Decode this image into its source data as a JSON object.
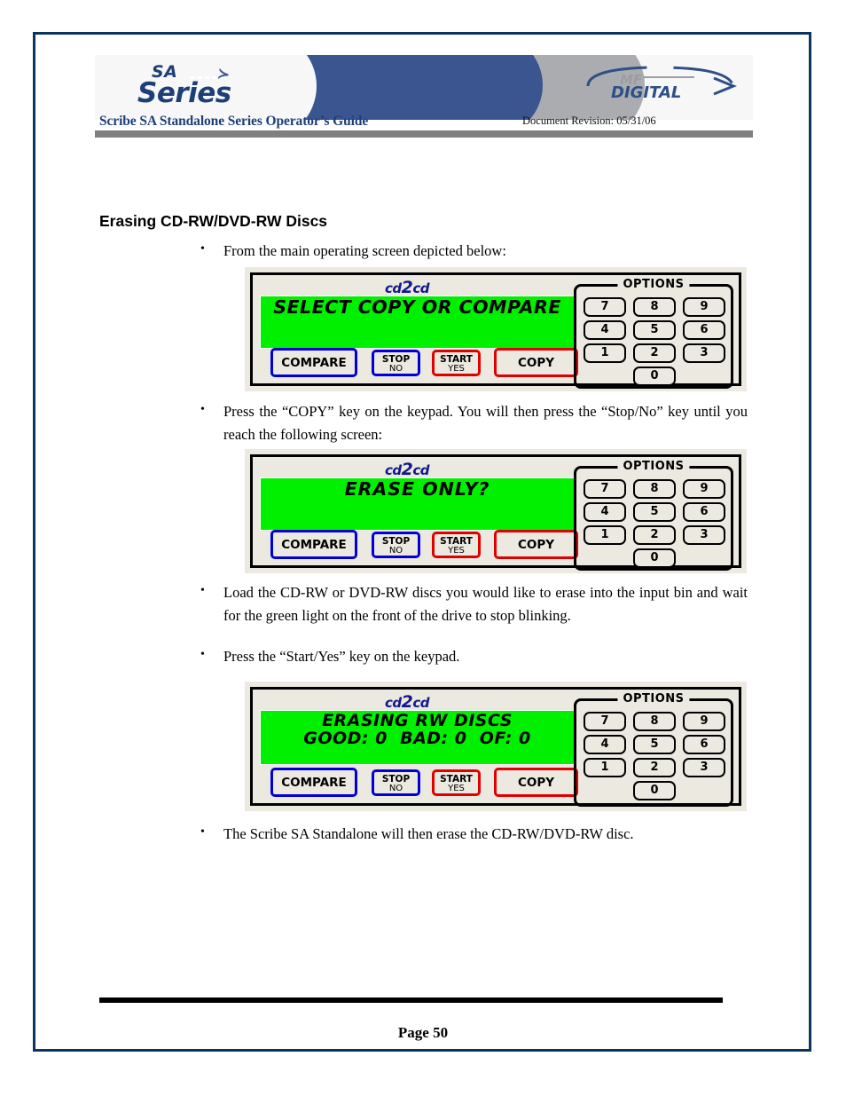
{
  "document": {
    "header": {
      "logo_sa_top": "SA",
      "logo_sa_bottom": "Series",
      "logo_bird": "≻",
      "brand_mf": "MF",
      "brand_digital": "DIGITAL",
      "title": "Scribe SA Standalone Series Operator’s Guide",
      "revision": "Document Revision: 05/31/06"
    },
    "section_heading": "Erasing CD-RW/DVD-RW Discs",
    "bullets": {
      "b1": "From the main operating screen depicted below:",
      "b2": "Press the “COPY” key on the keypad. You will then press the “Stop/No” key until you reach the following screen:",
      "b3": "Load the CD-RW or DVD-RW discs you would like to erase into the input bin and wait for the green light on the front of the drive to stop blinking.",
      "b4": "Press the “Start/Yes” key on the keypad.",
      "b5": "The Scribe SA Standalone will then erase the CD-RW/DVD-RW disc."
    },
    "footer": {
      "page_label": "Page 50"
    }
  },
  "device": {
    "brand_cd": "cd",
    "brand_2": "2",
    "brand_cd2": "cd",
    "options_label": "OPTIONS",
    "keys": [
      "7",
      "8",
      "9",
      "4",
      "5",
      "6",
      "1",
      "2",
      "3",
      "0"
    ],
    "buttons": {
      "compare": "COMPARE",
      "stop_main": "STOP",
      "stop_sub": "NO",
      "start_main": "START",
      "start_sub": "YES",
      "copy": "COPY"
    },
    "panels": [
      {
        "id": "panel-1",
        "lcd_line1": "SELECT COPY OR COMPARE",
        "lcd_line2": ""
      },
      {
        "id": "panel-2",
        "lcd_line1": "ERASE ONLY?",
        "lcd_line2": ""
      },
      {
        "id": "panel-3",
        "lcd_line1": "ERASING RW DISCS",
        "lcd_line2": "GOOD: 0  BAD: 0  OF: 0"
      }
    ]
  },
  "colors": {
    "page_border": "#0b3560",
    "header_blue": "#3b5591",
    "header_gray": "#aaacb0",
    "title_blue": "#1c3f78",
    "lcd_green": "#00f000",
    "button_blue": "#0000d8",
    "button_red": "#e00000",
    "panel_bg": "#ece9e1"
  }
}
